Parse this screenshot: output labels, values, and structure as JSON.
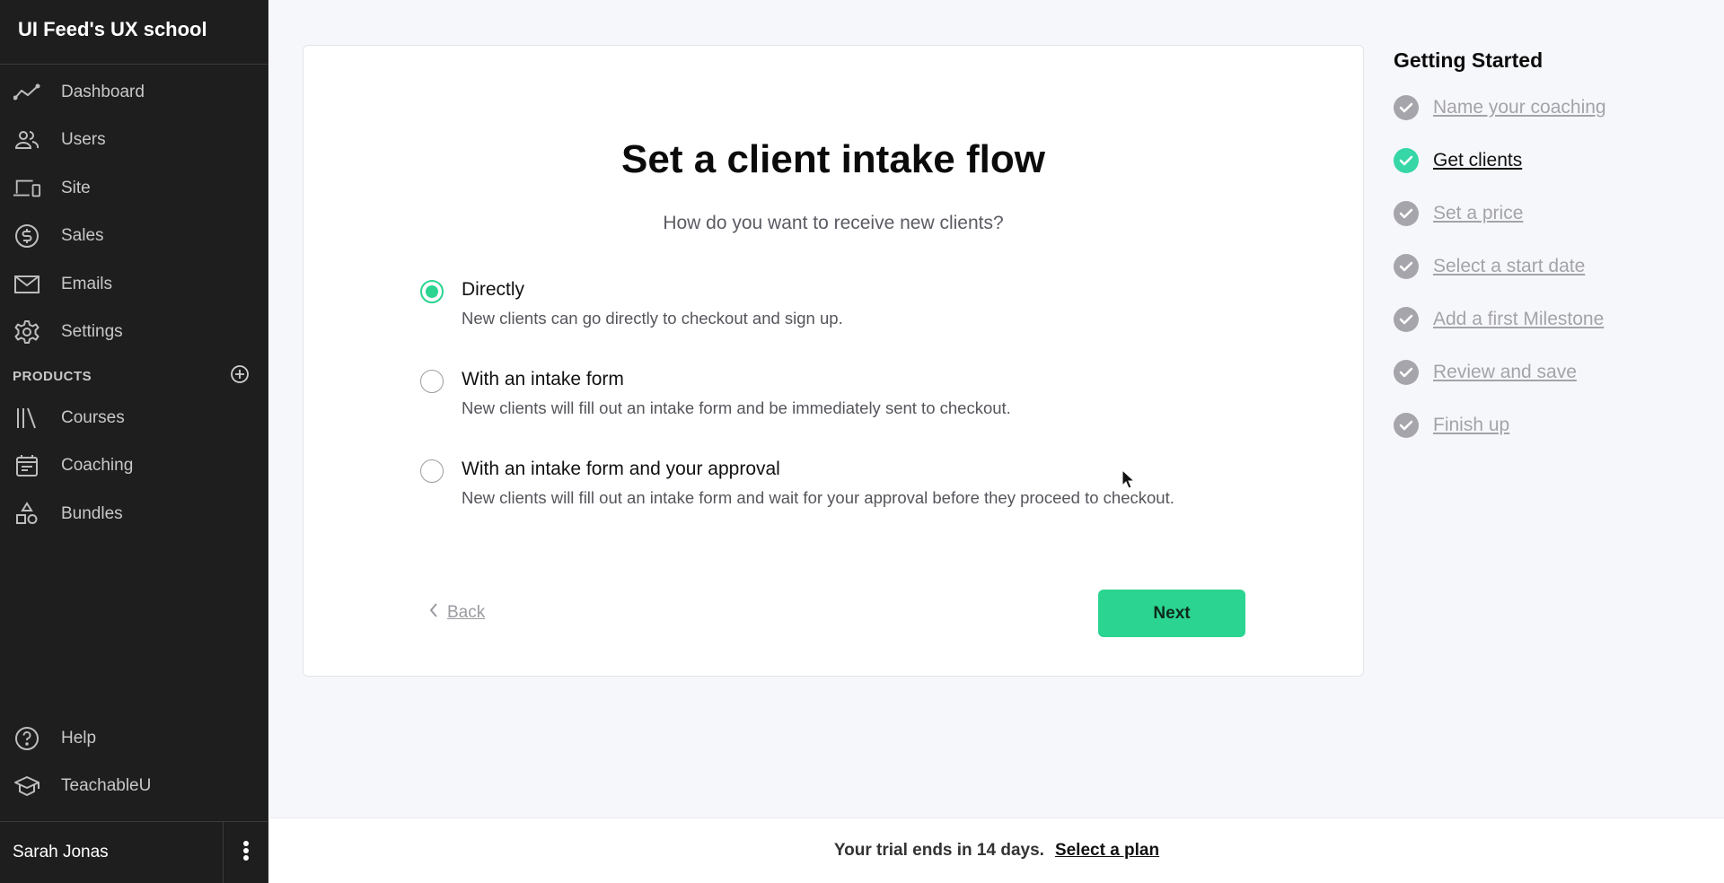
{
  "sidebar": {
    "brand": "UI Feed's UX school",
    "nav": [
      {
        "label": "Dashboard",
        "icon": "dashboard-icon"
      },
      {
        "label": "Users",
        "icon": "users-icon"
      },
      {
        "label": "Site",
        "icon": "site-icon"
      },
      {
        "label": "Sales",
        "icon": "sales-icon"
      },
      {
        "label": "Emails",
        "icon": "emails-icon"
      },
      {
        "label": "Settings",
        "icon": "settings-icon"
      }
    ],
    "products_header": "PRODUCTS",
    "products": [
      {
        "label": "Courses",
        "icon": "courses-icon"
      },
      {
        "label": "Coaching",
        "icon": "coaching-icon"
      },
      {
        "label": "Bundles",
        "icon": "bundles-icon"
      }
    ],
    "bottom": [
      {
        "label": "Help",
        "icon": "help-icon"
      },
      {
        "label": "TeachableU",
        "icon": "graduation-cap-icon"
      }
    ],
    "user_name": "Sarah Jonas"
  },
  "main": {
    "title": "Set a client intake flow",
    "subtitle": "How do you want to receive new clients?",
    "options": [
      {
        "title": "Directly",
        "description": "New clients can go directly to checkout and sign up.",
        "selected": true
      },
      {
        "title": "With an intake form",
        "description": "New clients will fill out an intake form and be immediately sent to checkout.",
        "selected": false
      },
      {
        "title": "With an intake form and your approval",
        "description": "New clients will fill out an intake form and wait for your approval before they proceed to checkout.",
        "selected": false
      }
    ],
    "back_label": "Back",
    "next_label": "Next"
  },
  "checklist": {
    "title": "Getting Started",
    "steps": [
      {
        "label": "Name your coaching",
        "active": false
      },
      {
        "label": "Get clients",
        "active": true
      },
      {
        "label": "Set a price",
        "active": false
      },
      {
        "label": "Select a start date",
        "active": false
      },
      {
        "label": "Add a first Milestone",
        "active": false
      },
      {
        "label": "Review and save",
        "active": false
      },
      {
        "label": "Finish up",
        "active": false
      }
    ]
  },
  "trial": {
    "message": "Your trial ends in 14 days.",
    "link": "Select a plan"
  },
  "colors": {
    "accent": "#2bd491",
    "sidebar_bg": "#1e1e1e",
    "page_bg": "#f6f7fb",
    "step_done": "#a5a5ab",
    "step_active": "#36d6a7"
  }
}
